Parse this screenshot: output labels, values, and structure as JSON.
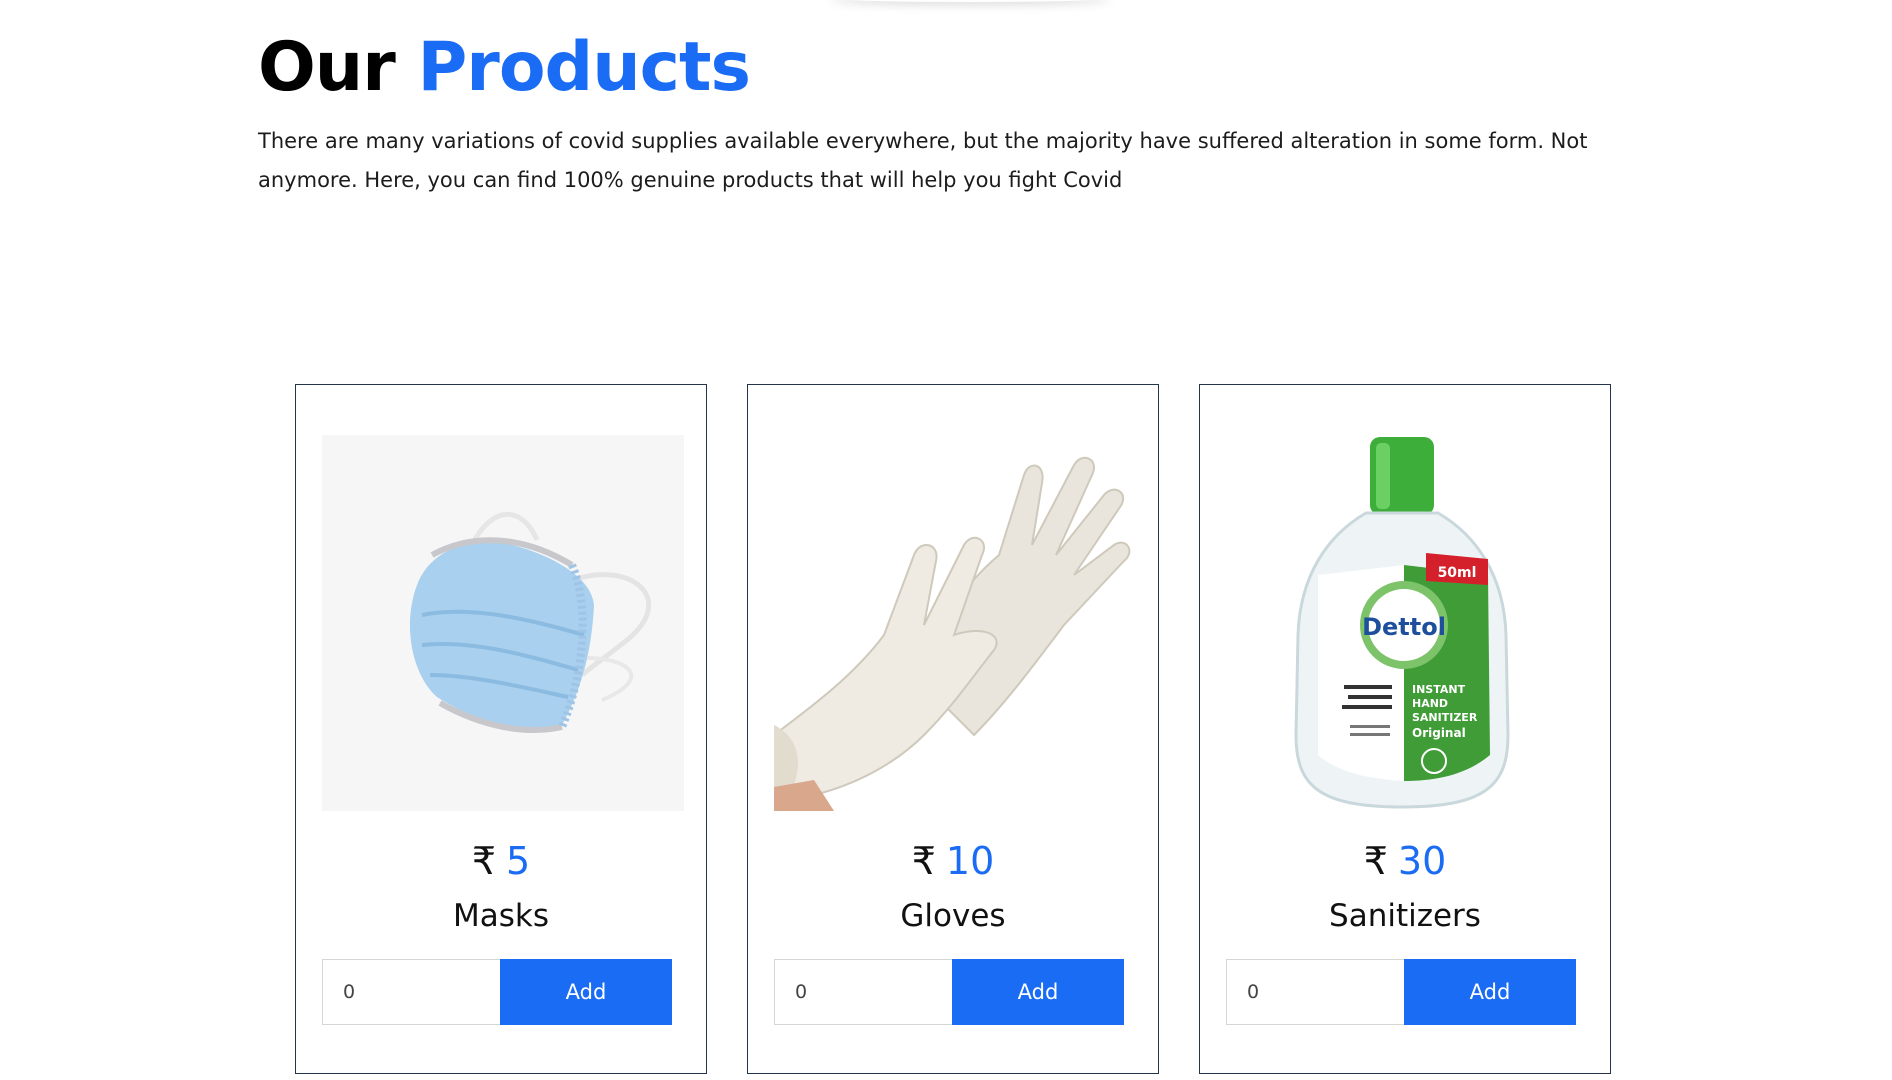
{
  "header": {
    "title_prefix": "Our",
    "title_highlight": "Products",
    "description": "There are many variations of covid supplies available everywhere, but the majority have suffered alteration in some form. Not anymore. Here, you can find 100% genuine products that will help you fight Covid"
  },
  "colors": {
    "accent": "#1a6cf5",
    "card_border": "#24344a"
  },
  "products": [
    {
      "name": "Masks",
      "currency": "₹",
      "price": "5",
      "quantity": "0",
      "add_label": "Add",
      "image": "surgical-mask-image"
    },
    {
      "name": "Gloves",
      "currency": "₹",
      "price": "10",
      "quantity": "0",
      "add_label": "Add",
      "image": "latex-gloves-image"
    },
    {
      "name": "Sanitizers",
      "currency": "₹",
      "price": "30",
      "quantity": "0",
      "add_label": "Add",
      "image": "hand-sanitizer-bottle-image",
      "image_text": {
        "brand": "Dettol",
        "volume": "50ml",
        "label_lines": [
          "INSTANT",
          "HAND",
          "SANITIZER",
          "Original"
        ]
      }
    }
  ]
}
